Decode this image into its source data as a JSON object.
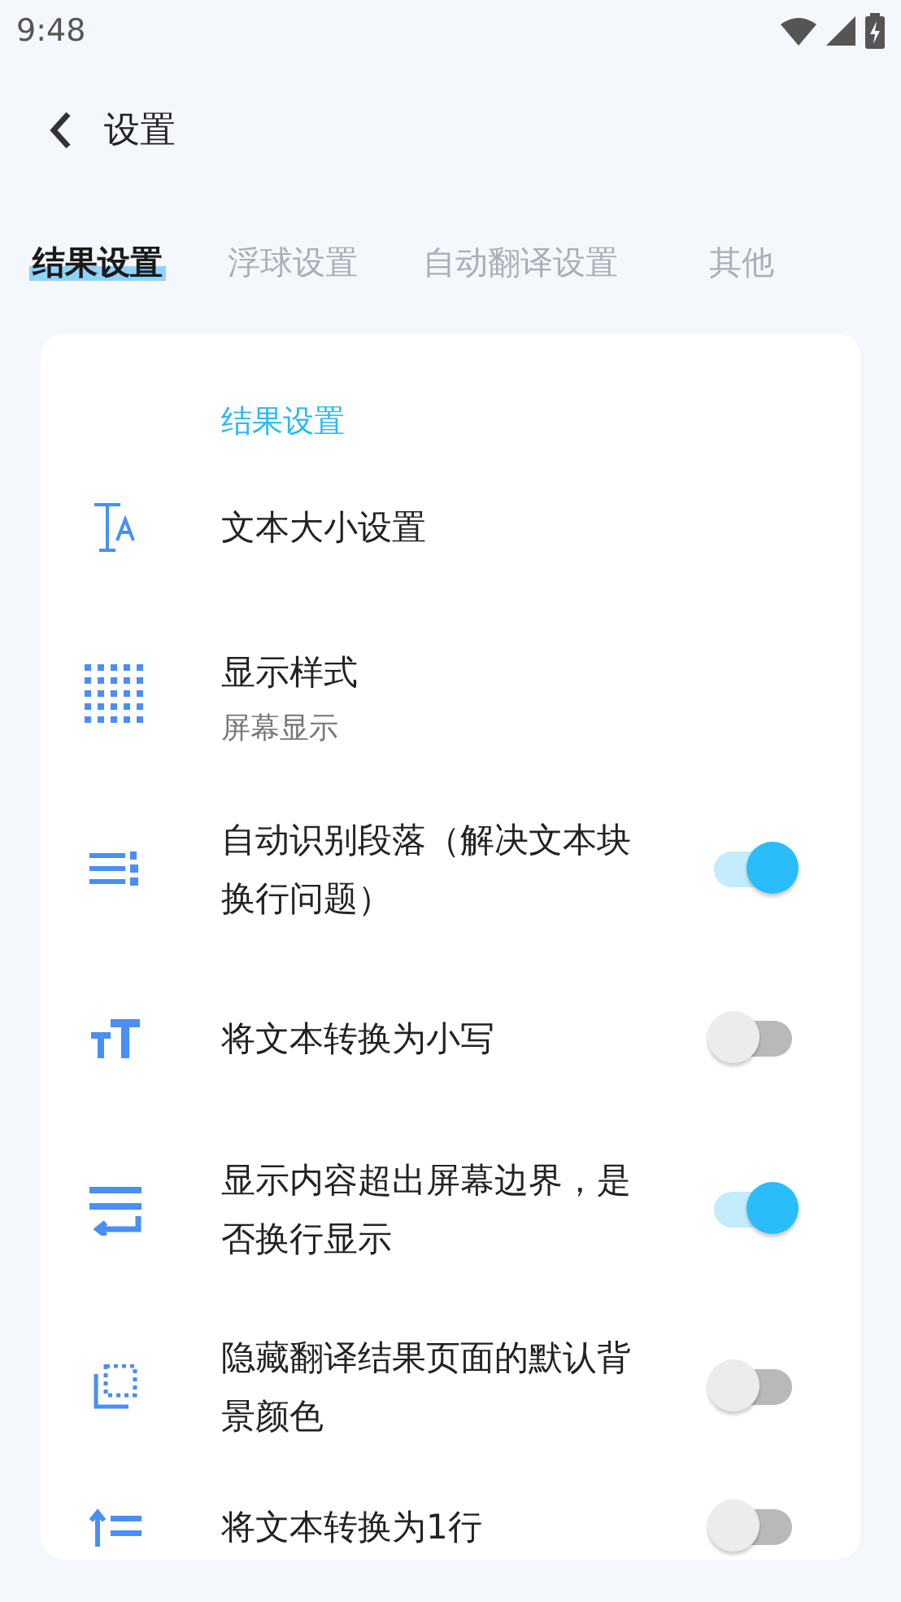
{
  "status_bar": {
    "time": "9:48"
  },
  "header": {
    "title": "设置"
  },
  "tabs": [
    {
      "label": "结果设置",
      "selected": true
    },
    {
      "label": "浮球设置",
      "selected": false
    },
    {
      "label": "自动翻译设置",
      "selected": false
    },
    {
      "label": "其他",
      "selected": false
    }
  ],
  "section": {
    "title": "结果设置"
  },
  "settings": [
    {
      "kind": "link",
      "label": "文本大小设置"
    },
    {
      "kind": "detail",
      "label": "显示样式",
      "value": "屏幕显示"
    },
    {
      "kind": "toggle",
      "label": "自动识别段落（解决文本块换行问题）",
      "on": true
    },
    {
      "kind": "toggle",
      "label": "将文本转换为小写",
      "on": false
    },
    {
      "kind": "toggle",
      "label": "显示内容超出屏幕边界，是否换行显示",
      "on": true
    },
    {
      "kind": "toggle",
      "label": "隐藏翻译结果页面的默认背景颜色",
      "on": false
    },
    {
      "kind": "toggle",
      "label": "将文本转换为1行",
      "on": false
    }
  ]
}
